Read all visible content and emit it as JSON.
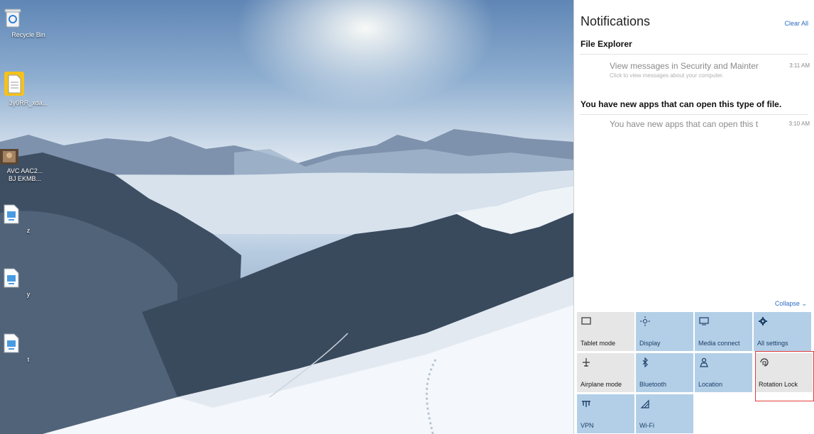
{
  "desktop": {
    "icons": [
      {
        "label": "Recycle Bin",
        "icon": "recycle-bin-icon"
      },
      {
        "label": "3y0RR_xda...",
        "icon": "document-icon"
      },
      {
        "label": "AVC AAC2...",
        "label2": "BJ EKMB...",
        "icon": "video-thumbnail-icon"
      },
      {
        "label": "z",
        "icon": "file-icon"
      },
      {
        "label": "y",
        "icon": "file-icon"
      },
      {
        "label": "t",
        "icon": "file-icon"
      }
    ]
  },
  "action_center": {
    "title": "Notifications",
    "clear_all": "Clear All",
    "groups": [
      {
        "title": "File Explorer",
        "notifications": [
          {
            "message": "View messages in Security and Mainter",
            "time": "3:11 AM",
            "subtext": "Click to view messages about your computer."
          }
        ]
      },
      {
        "title": "You have new apps that can open this type of file.",
        "notifications": [
          {
            "message": "You have new apps that can open this t",
            "time": "3:10 AM"
          }
        ]
      }
    ],
    "collapse_label": "Collapse",
    "tiles": [
      {
        "label": "Tablet mode",
        "icon": "tablet-mode-icon",
        "state": "off"
      },
      {
        "label": "Display",
        "icon": "display-brightness-icon",
        "state": "on"
      },
      {
        "label": "Media connect",
        "icon": "media-connect-icon",
        "state": "on"
      },
      {
        "label": "All settings",
        "icon": "gear-icon",
        "state": "on"
      },
      {
        "label": "Airplane mode",
        "icon": "airplane-icon",
        "state": "off"
      },
      {
        "label": "Bluetooth",
        "icon": "bluetooth-icon",
        "state": "on"
      },
      {
        "label": "Location",
        "icon": "location-icon",
        "state": "on"
      },
      {
        "label": "Rotation Lock",
        "icon": "rotation-lock-icon",
        "state": "off"
      },
      {
        "label": "VPN",
        "icon": "vpn-icon",
        "state": "on"
      },
      {
        "label": "Wi-Fi",
        "icon": "wifi-icon",
        "state": "on"
      }
    ]
  },
  "colors": {
    "accent": "#2b6cc4",
    "tile_on": "#b3cfe8",
    "tile_off": "#e6e6e6",
    "highlight": "#e23a3a"
  }
}
